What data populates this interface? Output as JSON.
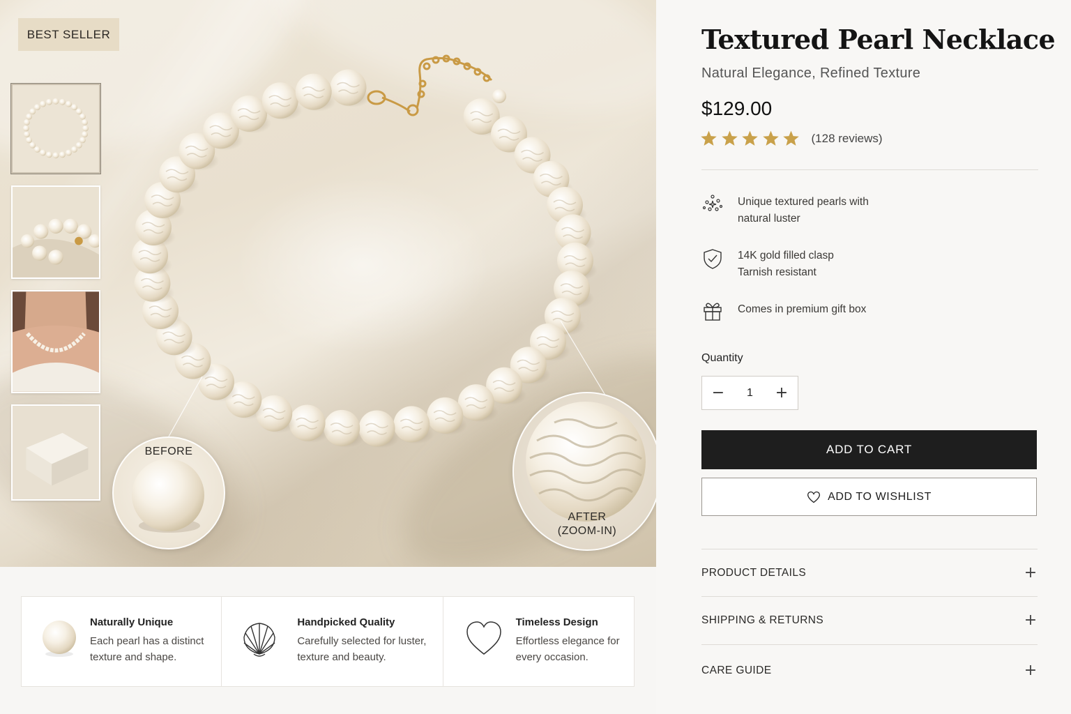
{
  "gallery": {
    "badge": "BEST SELLER",
    "thumbnails": [
      {
        "name": "bracelet-overview"
      },
      {
        "name": "pearl-closeup"
      },
      {
        "name": "model-wearing"
      },
      {
        "name": "gift-box"
      }
    ],
    "zoom_before_label": "BEFORE",
    "zoom_after_label_line1": "AFTER",
    "zoom_after_label_line2": "(ZOOM-IN)"
  },
  "features": [
    {
      "icon": "pearl-icon",
      "title": "Naturally Unique",
      "line1": "Each pearl has a distinct",
      "line2": "texture and shape."
    },
    {
      "icon": "shell-icon",
      "title": "Handpicked Quality",
      "line1": "Carefully selected for luster,",
      "line2": "texture and beauty."
    },
    {
      "icon": "heart-icon",
      "title": "Timeless Design",
      "line1": "Effortless elegance for",
      "line2": "every occasion."
    }
  ],
  "product": {
    "title": "Textured Pearl Necklace",
    "subtitle": "Natural Elegance, Refined Texture",
    "price": "$129.00",
    "rating": 5,
    "reviews": "(128 reviews)"
  },
  "bullets": [
    {
      "icon": "sparkle-icon",
      "line1": "Unique textured pearls with",
      "line2": "natural luster"
    },
    {
      "icon": "shield-check-icon",
      "line1": "14K gold filled clasp",
      "line2": "Tarnish resistant"
    },
    {
      "icon": "gift-icon",
      "line1": "Comes in premium gift box",
      "line2": ""
    }
  ],
  "quantity": {
    "label": "Quantity",
    "value": "1",
    "decrement": "−",
    "increment": "+"
  },
  "actions": {
    "add_to_cart": "ADD TO CART",
    "add_to_wishlist": "ADD TO WISHLIST"
  },
  "accordion": [
    {
      "label": "PRODUCT DETAILS",
      "toggle": "+"
    },
    {
      "label": "SHIPPING & RETURNS",
      "toggle": "+"
    },
    {
      "label": "CARE GUIDE",
      "toggle": "+"
    }
  ],
  "colors": {
    "accent_gold": "#c9a14a",
    "cart_button": "#1e1e1e",
    "badge_bg": "#e7dcc6"
  }
}
